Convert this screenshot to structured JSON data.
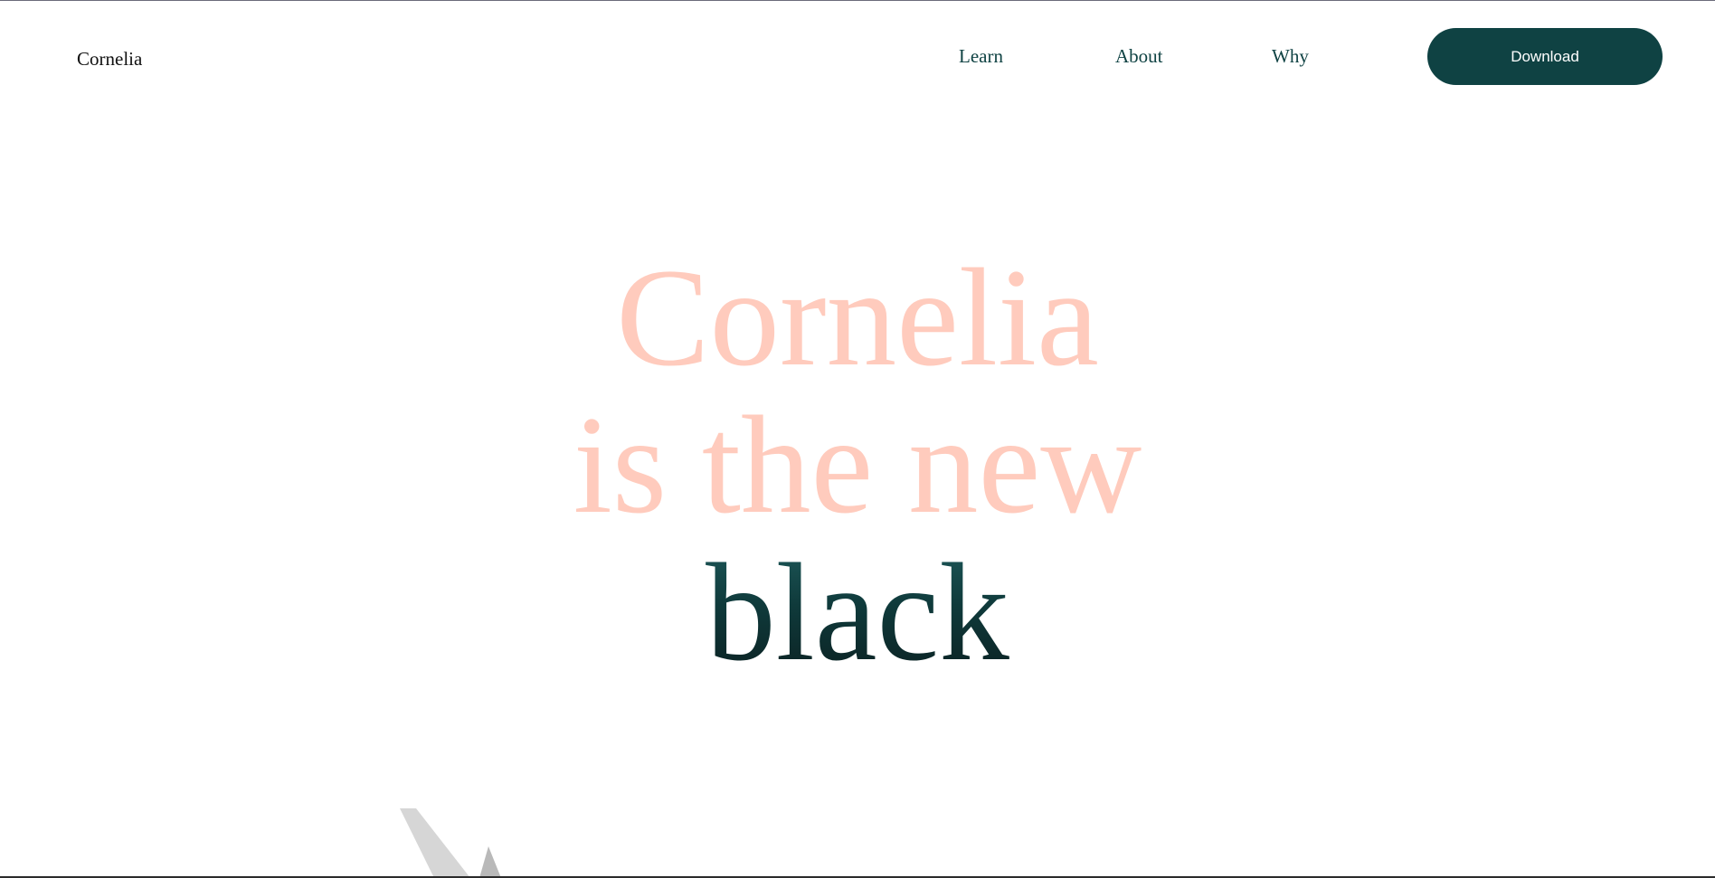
{
  "header": {
    "brand": "Cornelia",
    "nav": [
      {
        "label": "Learn"
      },
      {
        "label": "About"
      },
      {
        "label": "Why"
      }
    ],
    "download_label": "Download"
  },
  "hero": {
    "line1": "Cornelia",
    "line2": "is the new",
    "line3": "black"
  },
  "colors": {
    "accent": "#0f4243",
    "hero_light": "#ffcbbd",
    "background": "#ffffff"
  }
}
